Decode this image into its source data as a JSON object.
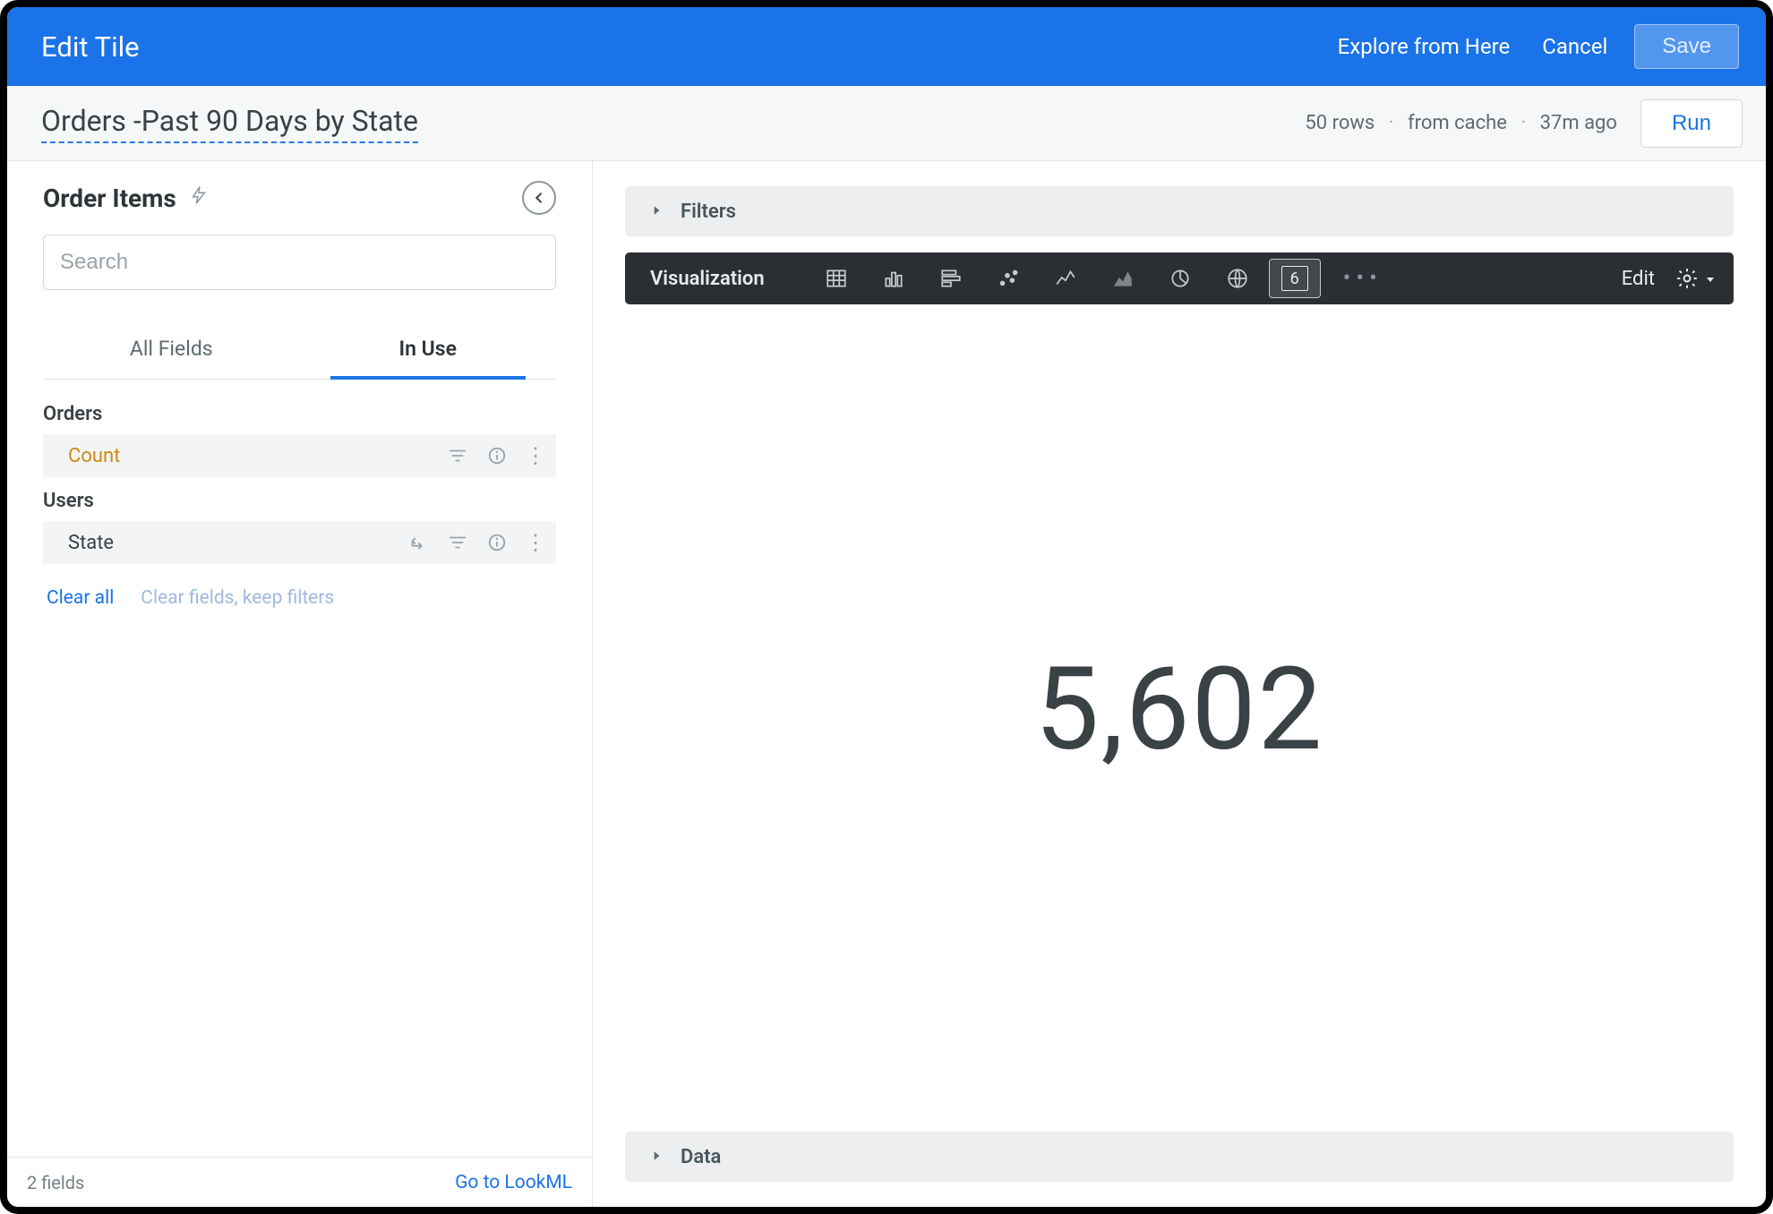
{
  "header": {
    "title": "Edit Tile",
    "explore_label": "Explore from Here",
    "cancel_label": "Cancel",
    "save_label": "Save"
  },
  "subheader": {
    "tile_title": "Orders -Past 90 Days by State",
    "rows": "50 rows",
    "cache": "from cache",
    "time_ago": "37m ago",
    "run_label": "Run"
  },
  "sidebar": {
    "explore_name": "Order Items",
    "search_placeholder": "Search",
    "tabs": {
      "all_fields": "All Fields",
      "in_use": "In Use"
    },
    "groups": [
      {
        "label": "Orders",
        "fields": [
          {
            "name": "Count",
            "type": "measure",
            "has_pivot": false
          }
        ]
      },
      {
        "label": "Users",
        "fields": [
          {
            "name": "State",
            "type": "dimension",
            "has_pivot": true
          }
        ]
      }
    ],
    "clear_all": "Clear all",
    "clear_keep": "Clear fields, keep filters",
    "footer_count": "2 fields",
    "go_lookml": "Go to LookML"
  },
  "panels": {
    "filters_label": "Filters",
    "visualization_label": "Visualization",
    "data_label": "Data",
    "edit_label": "Edit"
  },
  "viz_types": [
    {
      "name": "table-icon"
    },
    {
      "name": "column-chart-icon"
    },
    {
      "name": "bar-chart-icon"
    },
    {
      "name": "scatter-chart-icon"
    },
    {
      "name": "line-chart-icon"
    },
    {
      "name": "area-chart-icon"
    },
    {
      "name": "pie-chart-icon"
    },
    {
      "name": "map-chart-icon"
    },
    {
      "name": "single-value-icon",
      "glyph": "6",
      "selected": true
    }
  ],
  "visualization": {
    "single_value": "5,602"
  }
}
